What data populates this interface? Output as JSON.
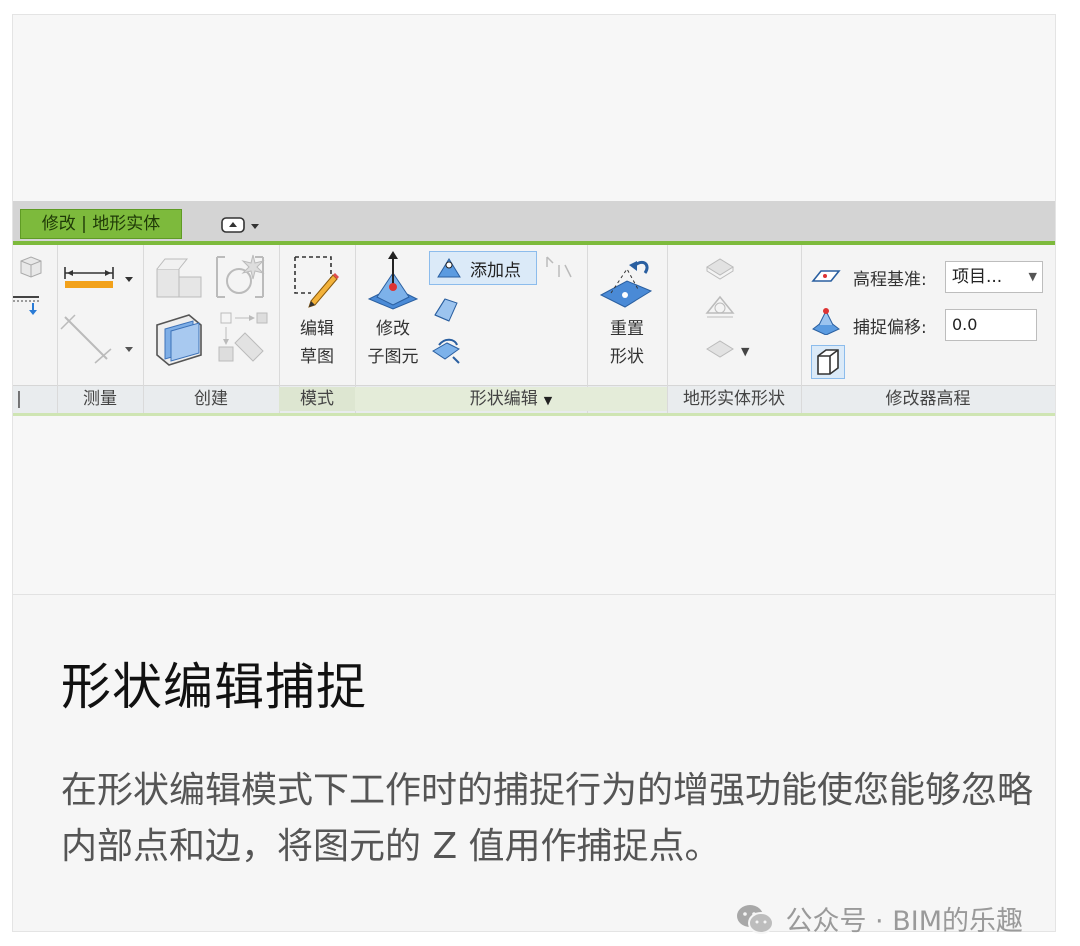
{
  "ribbon": {
    "context_tab": "修改 | 地形实体",
    "panels": {
      "measure": "测量",
      "create": "创建",
      "mode": "模式",
      "shape_edit": "形状编辑",
      "toposolid_shape": "地形实体形状",
      "modifier_elevation": "修改器高程"
    },
    "buttons": {
      "edit_sketch_line1": "编辑",
      "edit_sketch_line2": "草图",
      "modify_sub_line1": "修改",
      "modify_sub_line2": "子图元",
      "add_point": "添加点",
      "reset_shape_line1": "重置",
      "reset_shape_line2": "形状"
    },
    "properties": {
      "elevation_base_label": "高程基准:",
      "elevation_base_value": "项目...",
      "snap_offset_label": "捕捉偏移:",
      "snap_offset_value": "0.0"
    }
  },
  "article": {
    "title": "形状编辑捕捉",
    "description": "在形状编辑模式下工作时的捕捉行为的增强功能使您能够忽略内部点和边，将图元的 Z 值用作捕捉点。"
  },
  "watermark": "公众号 · BIM的乐趣",
  "colors": {
    "accent_green": "#7dba3c",
    "highlight_blue": "#dbeaf8"
  }
}
